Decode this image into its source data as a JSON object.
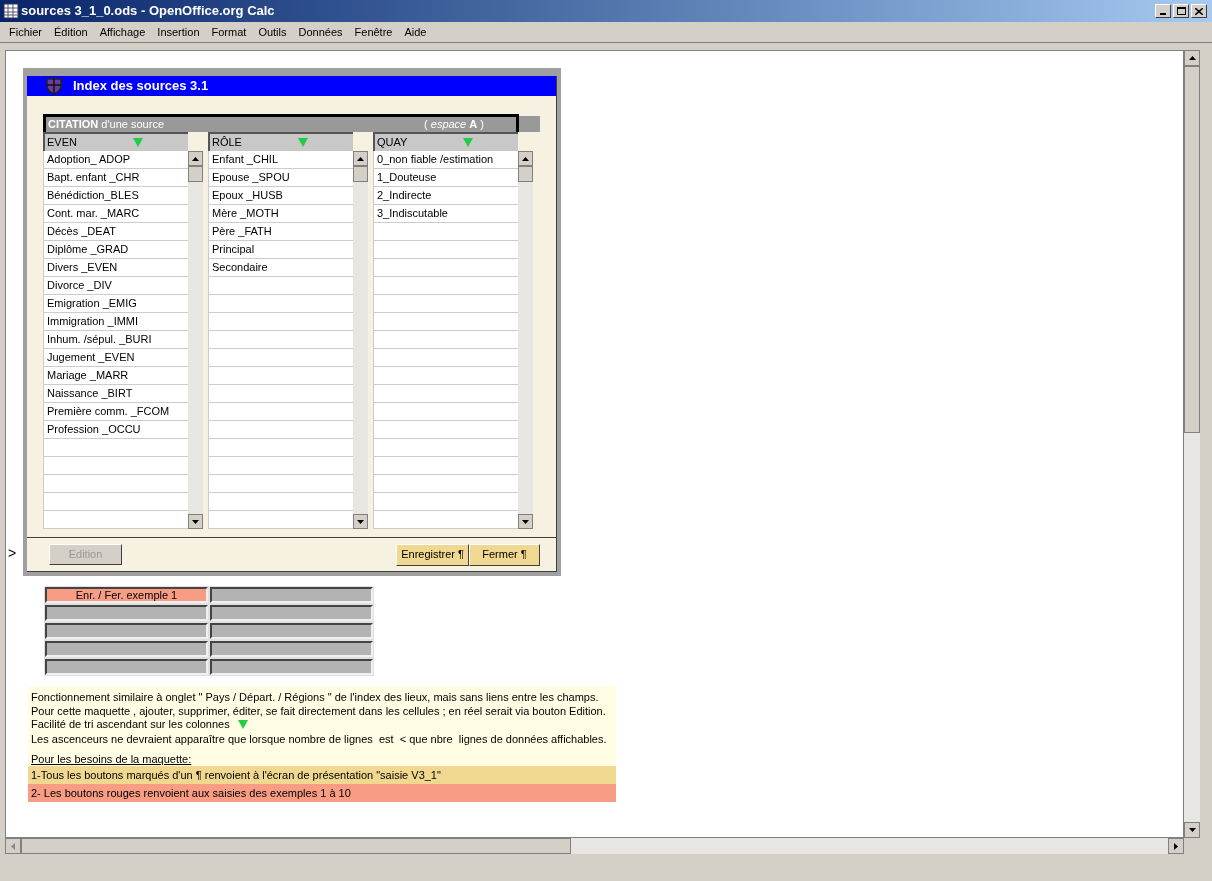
{
  "window": {
    "title": "sources 3_1_0.ods - OpenOffice.org Calc"
  },
  "menu": [
    "Fichier",
    "Édition",
    "Affichage",
    "Insertion",
    "Format",
    "Outils",
    "Données",
    "Fenêtre",
    "Aide"
  ],
  "dialog": {
    "title": "Index des sources 3.1",
    "header": {
      "label": "**CITATION** d'une source",
      "right": "( *espace* **A** )"
    },
    "columns": [
      {
        "label": "EVEN",
        "rows": [
          "Adoption_ ADOP",
          "Bapt. enfant _CHR",
          "Bénédiction_BLES",
          "Cont. mar. _MARC",
          "Décès _DEAT",
          "Diplôme _GRAD",
          "Divers _EVEN",
          "Divorce _DIV",
          "Emigration _EMIG",
          "Immigration _IMMI",
          "Inhum. /sépul. _BURI",
          "Jugement _EVEN",
          "Mariage _MARR",
          "Naissance _BIRT",
          "Première comm. _FCOM",
          "Profession _OCCU"
        ]
      },
      {
        "label": "RÔLE",
        "rows": [
          "Enfant _CHIL",
          "Epouse _SPOU",
          "Epoux _HUSB",
          "Mère _MOTH",
          "Père _FATH",
          "Principal",
          "Secondaire"
        ]
      },
      {
        "label": "QUAY",
        "rows": [
          "0_non fiable /estimation",
          "1_Douteuse",
          "2_Indirecte",
          "3_Indiscutable"
        ]
      }
    ],
    "buttons": [
      {
        "label": "Edition",
        "disabled": true,
        "kind": "left"
      },
      {
        "label": "Enregistrer ¶",
        "disabled": false,
        "kind": "right"
      },
      {
        "label": "Fermer ¶",
        "disabled": false,
        "kind": "right"
      }
    ]
  },
  "row_marker": ">",
  "examples": [
    {
      "label": "Enr. / Fer. exemple 1",
      "kind": "red"
    },
    {
      "kind": "gray"
    },
    {
      "kind": "gray"
    },
    {
      "kind": "gray"
    },
    {
      "kind": "gray"
    },
    {
      "kind": "gray"
    },
    {
      "kind": "gray"
    },
    {
      "kind": "gray"
    },
    {
      "kind": "gray"
    },
    {
      "kind": "gray"
    }
  ],
  "notes": [
    {
      "kind": "text",
      "text": "Fonctionnement similaire à onglet \" Pays / Départ. / Régions \" de l'index des lieux, mais sans liens entre les champs."
    },
    {
      "kind": "text",
      "text": "Pour cette maquette , ajouter, supprimer, éditer, se fait directement dans les cellules ; en réel serait via bouton Edition."
    },
    {
      "kind": "sort",
      "text": "Facilité de tri ascendant sur les colonnes"
    },
    {
      "kind": "text",
      "text": "Les ascenceurs ne devraient apparaître que lorsque nombre de lignes  est  < que nbre  lignes de données affichables."
    },
    {
      "kind": "heading",
      "text": "Pour les besoins de la maquette:"
    },
    {
      "kind": "highlight",
      "color": "#f0d890",
      "text": "1-Tous les boutons marqués d'un ¶ renvoient à l'écran de présentation \"saisie V3_1\""
    },
    {
      "kind": "highlight",
      "color": "#f99c84",
      "text": "2- Les boutons rouges renvoient aux saisies des exemples 1 à 10"
    }
  ]
}
